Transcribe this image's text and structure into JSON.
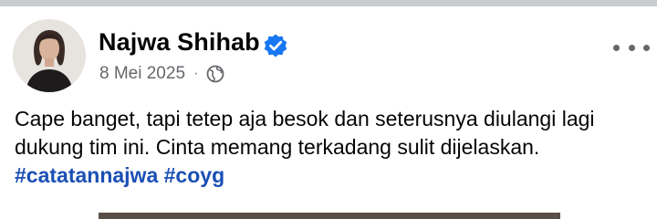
{
  "post": {
    "author": "Najwa Shihab",
    "date": "8 Mei 2025",
    "separator": "·",
    "privacy_icon": "globe-icon",
    "verified_icon": "verified-badge-icon",
    "more_icon": "more-options-icon",
    "body_text": "Cape banget, tapi tetep aja besok dan seterusnya diulangi lagi dukung tim ini. Cinta memang terkadang sulit dijelaskan.",
    "hashtags": [
      "#catatannajwa",
      "#coyg"
    ]
  },
  "colors": {
    "name": "#050505",
    "meta": "#65676b",
    "hashtag": "#1b4fb4",
    "verified": "#1877f2"
  }
}
